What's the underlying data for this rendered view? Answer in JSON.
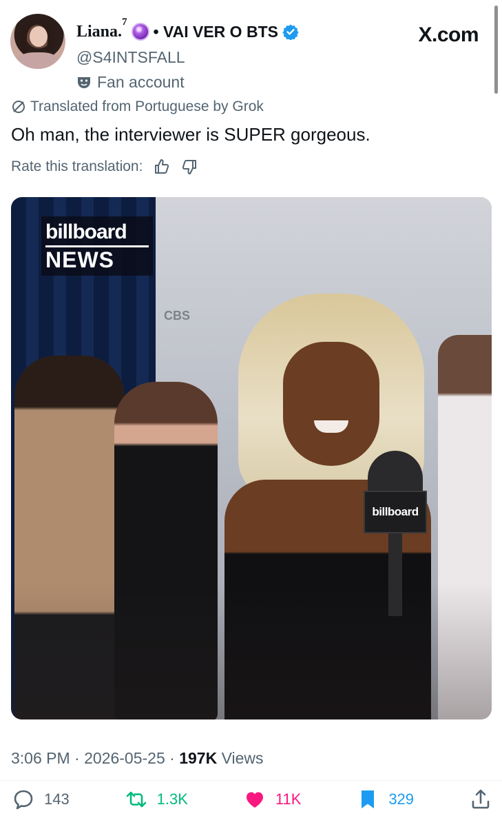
{
  "header": {
    "display_name": "Liana.",
    "superscript": "7",
    "name_suffix": "• VAI VER O BTS",
    "handle": "@S4INTSFALL",
    "account_label": "Fan account",
    "site": "X.com"
  },
  "tweet": {
    "translated_notice": "Translated from Portuguese by Grok",
    "text": "Oh man, the interviewer is SUPER gorgeous.",
    "rate_label": "Rate this translation:"
  },
  "media": {
    "logo_line1": "billboard",
    "logo_line2": "NEWS",
    "backdrop_text": "CBS",
    "mic_flag": "billboard"
  },
  "meta": {
    "time": "3:06 PM",
    "date": "2026-05-25",
    "views_count": "197K",
    "views_label": "Views"
  },
  "actions": {
    "replies": "143",
    "reposts": "1.3K",
    "likes": "11K",
    "bookmarks": "329"
  },
  "colors": {
    "text": "#0f1419",
    "secondary": "#536471",
    "verified": "#1d9bf0",
    "repost": "#00ba7c",
    "like": "#f91880",
    "bookmark": "#1d9bf0"
  },
  "icons": [
    "crystal-ball-icon",
    "verified-badge-icon",
    "mask-icon",
    "translate-icon",
    "thumbs-up-icon",
    "thumbs-down-icon",
    "reply-icon",
    "repost-icon",
    "like-icon",
    "bookmark-icon",
    "share-icon"
  ]
}
